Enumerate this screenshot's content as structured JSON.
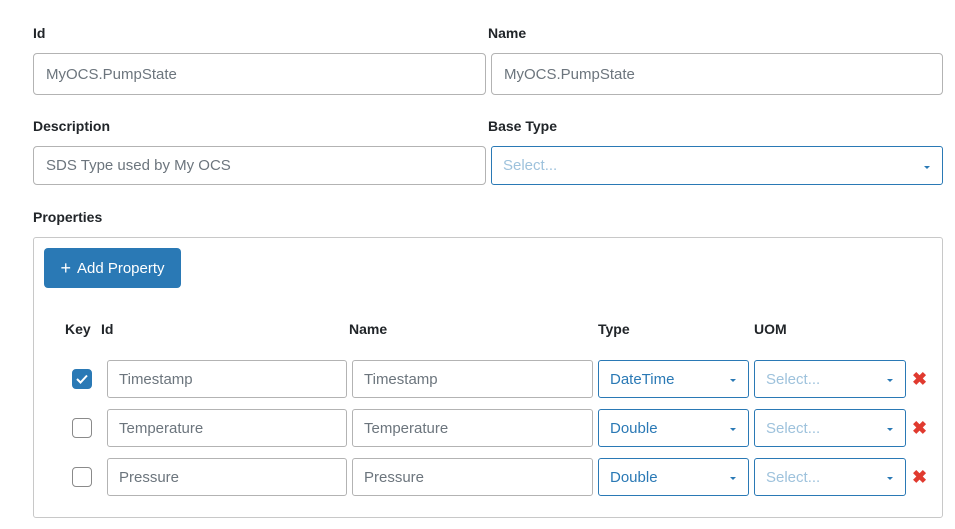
{
  "form": {
    "id_label": "Id",
    "id_value": "MyOCS.PumpState",
    "name_label": "Name",
    "name_value": "MyOCS.PumpState",
    "description_label": "Description",
    "description_value": "SDS Type used by My OCS",
    "base_type_label": "Base Type",
    "base_type_placeholder": "Select...",
    "properties_label": "Properties"
  },
  "properties": {
    "add_button_label": "Add Property",
    "add_button_icon": "+",
    "columns": {
      "key": "Key",
      "id": "Id",
      "name": "Name",
      "type": "Type",
      "uom": "UOM"
    },
    "rows": [
      {
        "key_checked": true,
        "id": "Timestamp",
        "name": "Timestamp",
        "type": "DateTime",
        "uom_placeholder": "Select..."
      },
      {
        "key_checked": false,
        "id": "Temperature",
        "name": "Temperature",
        "type": "Double",
        "uom_placeholder": "Select..."
      },
      {
        "key_checked": false,
        "id": "Pressure",
        "name": "Pressure",
        "type": "Double",
        "uom_placeholder": "Select..."
      }
    ],
    "delete_icon": "✖"
  },
  "colors": {
    "accent": "#2a79b5",
    "delete": "#e03a2f",
    "border": "#b3b3b3"
  }
}
